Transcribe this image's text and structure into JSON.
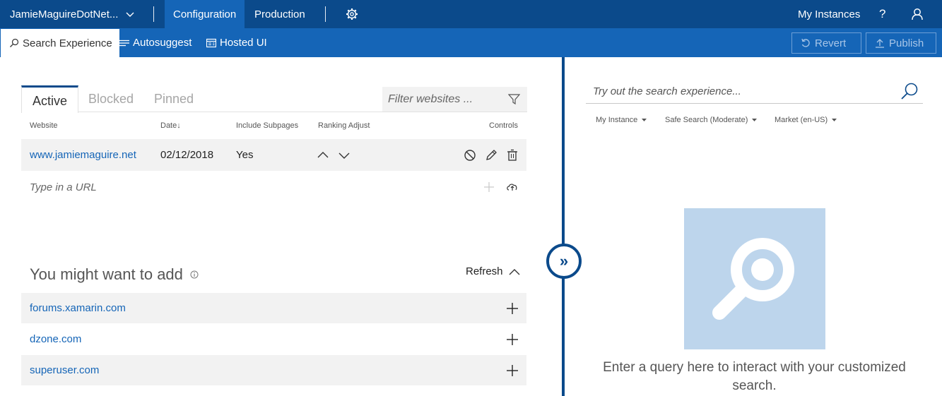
{
  "topbar": {
    "instance_name": "JamieMaguireDotNet...",
    "tabs": [
      {
        "label": "Configuration"
      },
      {
        "label": "Production"
      }
    ],
    "my_instances": "My Instances",
    "help": "?"
  },
  "subbar": {
    "tabs": [
      {
        "label": "Search Experience"
      },
      {
        "label": "Autosuggest"
      },
      {
        "label": "Hosted UI"
      }
    ],
    "revert": "Revert",
    "publish": "Publish"
  },
  "left": {
    "tabs": [
      {
        "label": "Active"
      },
      {
        "label": "Blocked"
      },
      {
        "label": "Pinned"
      }
    ],
    "filter_placeholder": "Filter websites ...",
    "columns": {
      "website": "Website",
      "date": "Date↓",
      "subpages": "Include Subpages",
      "ranking": "Ranking Adjust",
      "controls": "Controls"
    },
    "rows": [
      {
        "website": "www.jamiemaguire.net",
        "date": "02/12/2018",
        "subpages": "Yes"
      }
    ],
    "url_placeholder": "Type in a URL",
    "suggest_title": "You might want to add",
    "refresh": "Refresh",
    "suggestions": [
      {
        "site": "forums.xamarin.com"
      },
      {
        "site": "dzone.com"
      },
      {
        "site": "superuser.com"
      }
    ]
  },
  "right": {
    "search_placeholder": "Try out the search experience...",
    "dropdowns": [
      {
        "label": "My Instance"
      },
      {
        "label": "Safe Search (Moderate)"
      },
      {
        "label": "Market (en-US)"
      }
    ],
    "hint": "Enter a query here to interact with your customized search."
  },
  "splitter": {
    "glyph": "»"
  },
  "colors": {
    "topbar": "#0b4a8b",
    "subbar": "#1565b7",
    "link": "#1565b7",
    "hero": "#bdd5ec"
  }
}
